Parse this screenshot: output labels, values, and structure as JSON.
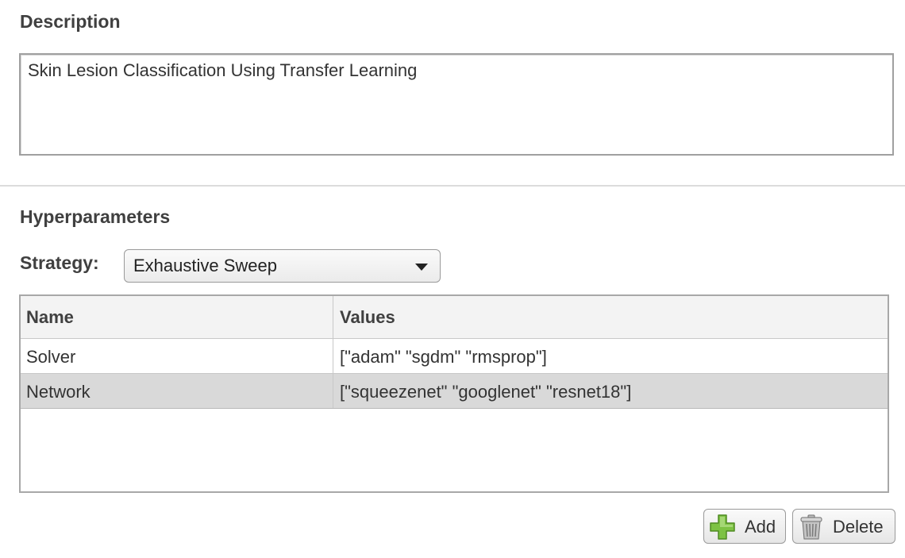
{
  "description": {
    "title": "Description",
    "text": "Skin Lesion Classification Using Transfer Learning"
  },
  "hyperparameters": {
    "title": "Hyperparameters",
    "strategy_label": "Strategy:",
    "strategy_value": "Exhaustive Sweep",
    "columns": [
      "Name",
      "Values"
    ],
    "rows": [
      {
        "name": "Solver",
        "values": "[\"adam\" \"sgdm\" \"rmsprop\"]",
        "selected": false
      },
      {
        "name": "Network",
        "values": "[\"squeezenet\" \"googlenet\" \"resnet18\"]",
        "selected": true
      }
    ]
  },
  "buttons": {
    "add_label": "Add",
    "add_icon": "plus-icon",
    "delete_label": "Delete",
    "delete_icon": "trash-icon"
  },
  "colors": {
    "selected_row": "#d9d9d9",
    "header_bg": "#f3f3f3",
    "add_icon_green": "#7dc243"
  }
}
